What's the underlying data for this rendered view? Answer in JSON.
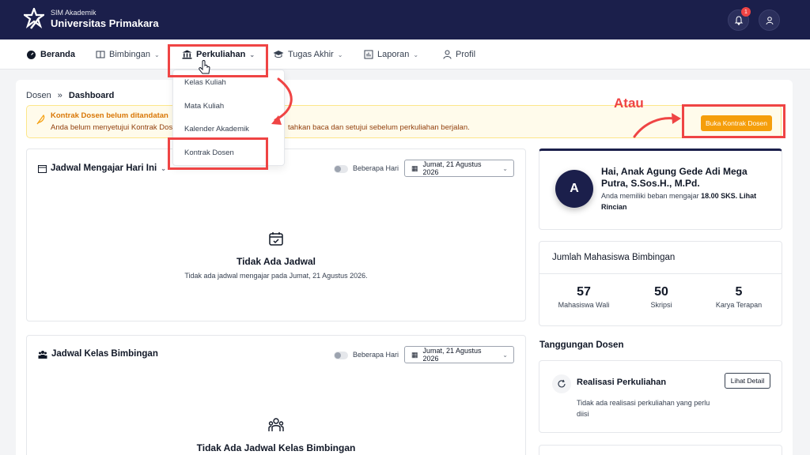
{
  "header": {
    "app_subtitle": "SIM Akademik",
    "app_title": "Universitas Primakara",
    "notification_count": "1"
  },
  "nav": {
    "items": [
      {
        "label": "Beranda",
        "icon": "dashboard-icon"
      },
      {
        "label": "Bimbingan",
        "icon": "book-icon"
      },
      {
        "label": "Perkuliahan",
        "icon": "building-icon"
      },
      {
        "label": "Tugas Akhir",
        "icon": "graduation-cap-icon"
      },
      {
        "label": "Laporan",
        "icon": "report-icon"
      },
      {
        "label": "Profil",
        "icon": "user-icon"
      }
    ],
    "dropdown": [
      "Kelas Kuliah",
      "Mata Kuliah",
      "Kalender Akademik",
      "Kontrak Dosen"
    ]
  },
  "breadcrumb": {
    "root": "Dosen",
    "separator": "»",
    "current": "Dashboard"
  },
  "alert": {
    "title": "Kontrak Dosen belum ditandatan",
    "body": "Anda belum menyetujui Kontrak Dos",
    "tail": "tahkan baca dan setujui sebelum perkuliahan berjalan.",
    "button": "Buka Kontrak Dosen"
  },
  "annotation": {
    "atau": "Atau",
    "color": "#ef4444"
  },
  "jadwal_mengajar": {
    "title": "Jadwal Mengajar Hari Ini",
    "toggle_label": "Beberapa Hari",
    "date": "Jumat, 21 Agustus 2026",
    "empty_title": "Tidak Ada Jadwal",
    "empty_sub": "Tidak ada jadwal mengajar pada Jumat, 21 Agustus 2026."
  },
  "jadwal_bimbingan": {
    "title": "Jadwal Kelas Bimbingan",
    "toggle_label": "Beberapa Hari",
    "date": "Jumat, 21 Agustus 2026",
    "empty_title": "Tidak Ada Jadwal Kelas Bimbingan"
  },
  "profile": {
    "initial": "A",
    "greeting": "Hai, Anak Agung Gede Adi Mega Putra, S.Sos.H., M.Pd.",
    "load_prefix": "Anda memiliki beban mengajar",
    "load_value": "18.00 SKS.",
    "load_link": "Lihat Rincian"
  },
  "stats": {
    "title": "Jumlah Mahasiswa Bimbingan",
    "items": [
      {
        "value": "57",
        "label": "Mahasiswa Wali"
      },
      {
        "value": "50",
        "label": "Skripsi"
      },
      {
        "value": "5",
        "label": "Karya Terapan"
      }
    ]
  },
  "tanggungan": {
    "title": "Tanggungan Dosen",
    "item_title": "Realisasi Perkuliahan",
    "button": "Lihat Detail",
    "text": "Tidak ada realisasi perkuliahan yang perlu diisi"
  },
  "colors": {
    "navy": "#1b1f4b",
    "accent": "#f59e0b",
    "highlight": "#ef4444"
  }
}
